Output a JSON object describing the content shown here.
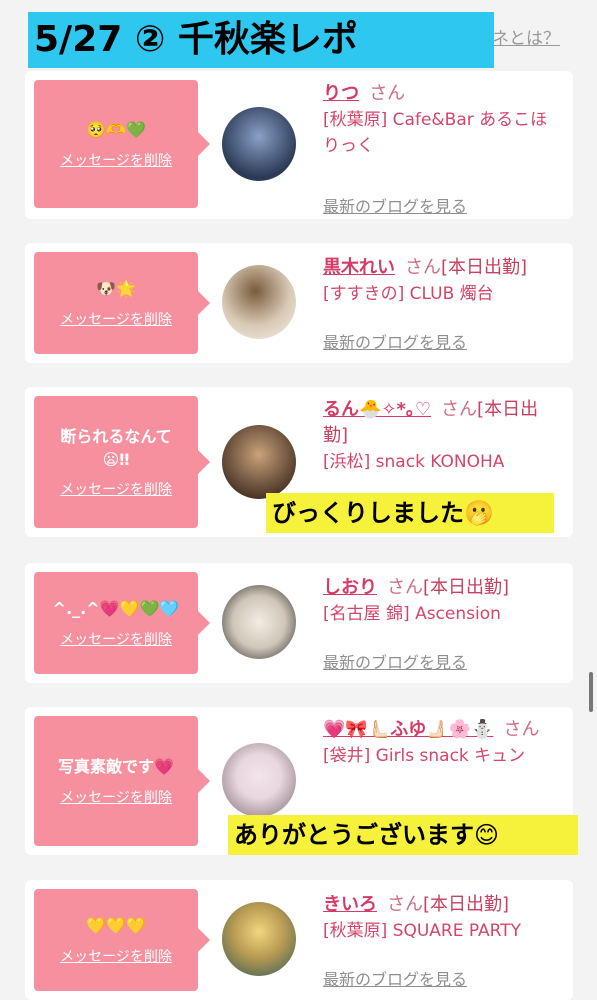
{
  "header": {
    "title": "5/27 ② 千秋楽レポ",
    "right_link": "ネとは？",
    "left_edge": "〈"
  },
  "labels": {
    "delete": "メッセージを削除",
    "blog": "最新のブログを見る",
    "san": "さん"
  },
  "cards": [
    {
      "message": "🥺🫶💚",
      "name": "りつ",
      "status": "",
      "shop": "[秋葉原] Cafe&Bar あるこほりっく",
      "avatar_colors": [
        "#2b3a55",
        "#8aa0c8"
      ]
    },
    {
      "message": "🐶🌟",
      "name": "黒木れい",
      "status": "[本日出勤]",
      "shop": "[すすきの] CLUB 燭台",
      "avatar_colors": [
        "#d9c9b5",
        "#7a5b3c"
      ]
    },
    {
      "message": "断られるなんて😦‼",
      "name": "るん🐣✧*｡♡",
      "status": "[本日出勤]",
      "shop": "[浜松] snack KONOHA",
      "avatar_colors": [
        "#4a3526",
        "#c9a27a"
      ]
    },
    {
      "message": "^._.^💗💛💚🩵",
      "name": "しおり",
      "status": "[本日出勤]",
      "shop": "[名古屋 錦] Ascension",
      "avatar_colors": [
        "#f1ede4",
        "#222222"
      ]
    },
    {
      "message": "写真素敵です💗",
      "name": "💗🎀🫷🏻ふゆ🫸🏻🌸⛄",
      "status": "",
      "shop": "[袋井] Girls snack キュン",
      "avatar_colors": [
        "#e8d7df",
        "#7d6a73"
      ]
    },
    {
      "message": "💛💛💛",
      "name": "きいろ",
      "status": "[本日出勤]",
      "shop": "[秋葉原] SQUARE PARTY",
      "avatar_colors": [
        "#2f5a55",
        "#f2d680"
      ]
    }
  ],
  "overlays": {
    "surprised": "びっくりしました🫢",
    "thanks": "ありがとうございます😊"
  }
}
